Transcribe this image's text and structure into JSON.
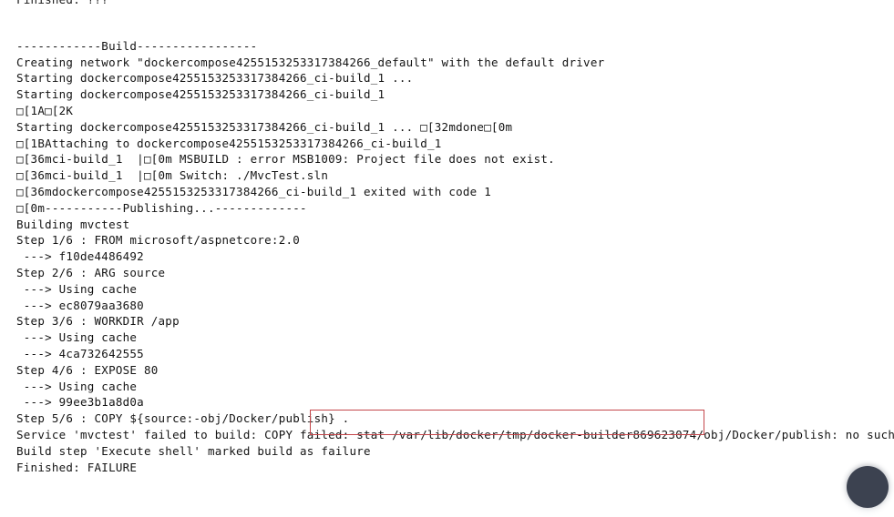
{
  "console": {
    "name": "jenkins-build-console-output",
    "background_color": "#ffffff",
    "text_color": "#141414",
    "clipped_top_line": "Finished: ???",
    "lines": [
      "",
      "------------Build-----------------",
      "Creating network \"dockercompose4255153253317384266_default\" with the default driver",
      "Starting dockercompose4255153253317384266_ci-build_1 ...",
      "Starting dockercompose4255153253317384266_ci-build_1",
      "□[1A□[2K",
      "Starting dockercompose4255153253317384266_ci-build_1 ... □[32mdone□[0m",
      "□[1BAttaching to dockercompose4255153253317384266_ci-build_1",
      "□[36mci-build_1  |□[0m MSBUILD : error MSB1009: Project file does not exist.",
      "□[36mci-build_1  |□[0m Switch: ./MvcTest.sln",
      "□[36mdockercompose4255153253317384266_ci-build_1 exited with code 1",
      "□[0m-----------Publishing...-------------",
      "Building mvctest",
      "Step 1/6 : FROM microsoft/aspnetcore:2.0",
      " ---> f10de4486492",
      "Step 2/6 : ARG source",
      " ---> Using cache",
      " ---> ec8079aa3680",
      "Step 3/6 : WORKDIR /app",
      " ---> Using cache",
      " ---> 4ca732642555",
      "Step 4/6 : EXPOSE 80",
      " ---> Using cache",
      " ---> 99ee3b1a8d0a",
      "Step 5/6 : COPY ${source:-obj/Docker/publish} .",
      "Service 'mvctest' failed to build: COPY failed: stat /var/lib/docker/tmp/docker-builder869623074/obj/Docker/publish: no such file or directory",
      "Build step 'Execute shell' marked build as failure",
      "Finished: FAILURE"
    ]
  },
  "annotation": {
    "name": "error-path-highlight",
    "color": "#c4474b",
    "highlighted_text": "stat /var/lib/docker/tmp/docker-builder869623074/obj/Docker/publish:"
  },
  "corner_widget": {
    "name": "floating-action-button",
    "color": "#3c4250"
  }
}
